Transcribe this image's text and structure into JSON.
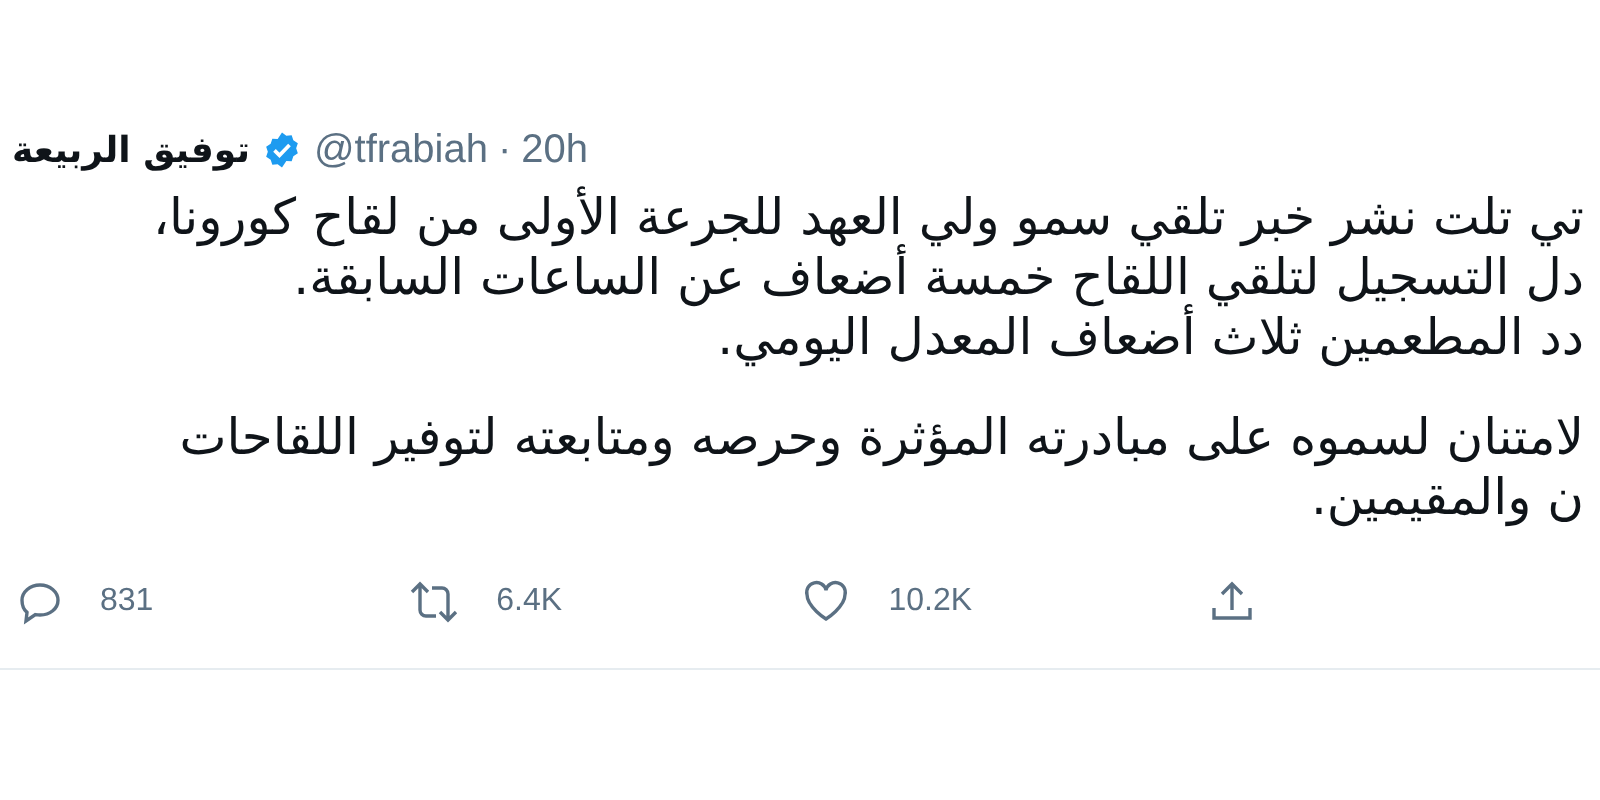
{
  "tweet": {
    "author": {
      "name": "توفيق الربيعة",
      "verified": true,
      "handle": "@tfrabiah",
      "separator": "·",
      "time": "20h"
    },
    "paragraphs": [
      [
        "تي تلت نشر خبر تلقي سمو ولي العهد للجرعة الأولى من لقاح كورونا،",
        "دل التسجيل لتلقي اللقاح خمسة أضعاف عن الساعات السابقة.",
        "دد المطعمين ثلاث أضعاف المعدل اليومي."
      ],
      [
        "لامتنان لسموه على مبادرته المؤثرة وحرصه ومتابعته لتوفير اللقاحات",
        "ن والمقيمين."
      ]
    ],
    "reply_count": "831",
    "retweet_count": "6.4K",
    "like_count": "10.2K"
  }
}
